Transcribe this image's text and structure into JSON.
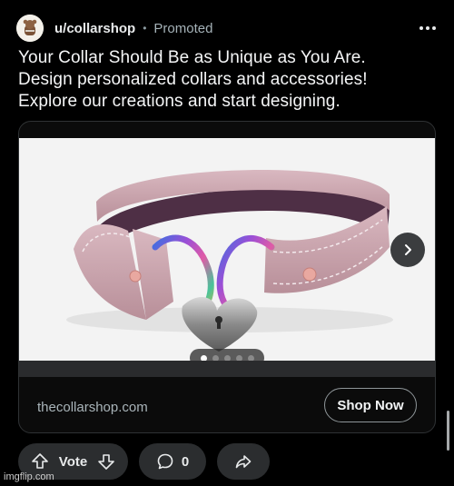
{
  "post": {
    "username": "u/collarshop",
    "separator": "•",
    "promoted_label": "Promoted",
    "headline_line1": "Your Collar Should Be as Unique as You Are.",
    "headline_line2": "Design personalized collars and accessories!",
    "headline_line3": "Explore our creations and start designing."
  },
  "ad_card": {
    "domain": "thecollarshop.com",
    "cta_label": "Shop Now",
    "carousel_total": 5,
    "carousel_current": 1
  },
  "actions": {
    "vote_label": "Vote",
    "comment_count": "0"
  },
  "watermark": "imgflip.com",
  "colors": {
    "background": "#000000",
    "pill": "#2b2d2f",
    "card_border": "#2f3234",
    "collar": "#c9a3ad"
  },
  "icons": [
    "reddit-avatar-icon",
    "more-options-icon",
    "chevron-right-icon",
    "upvote-icon",
    "downvote-icon",
    "comment-icon",
    "share-icon"
  ]
}
